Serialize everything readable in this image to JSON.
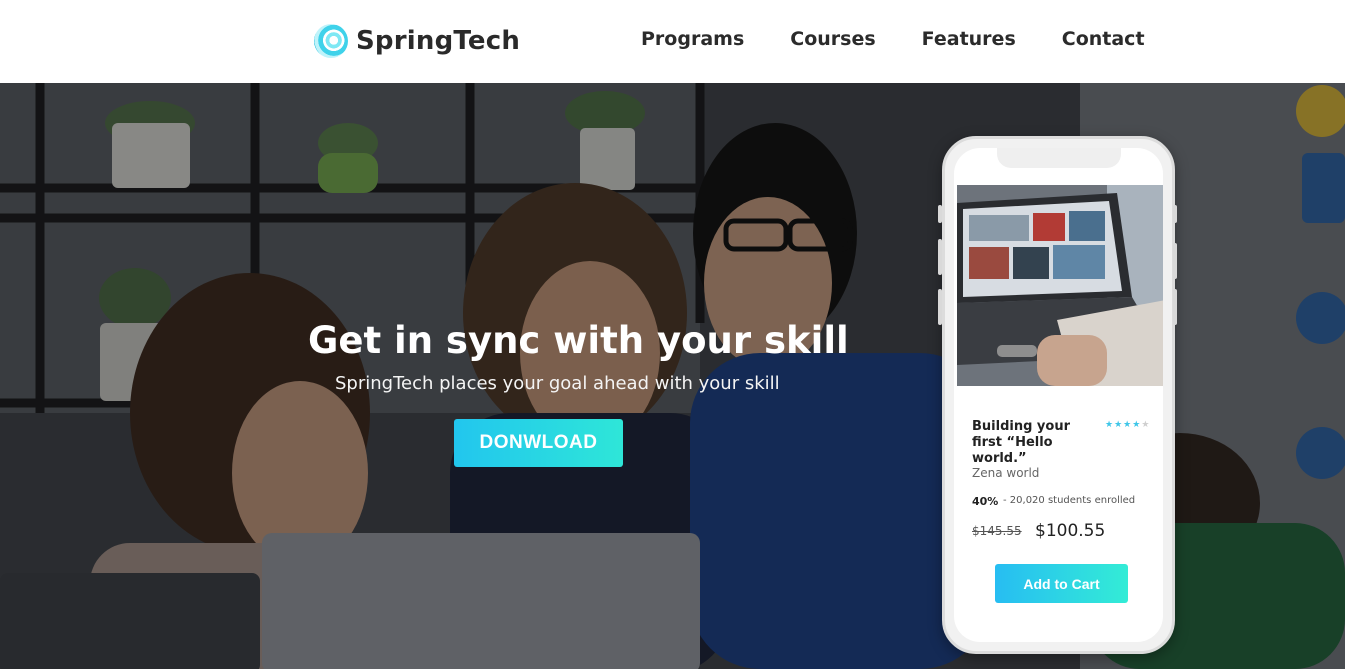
{
  "brand": {
    "name": "SpringTech",
    "logo_icon": "spiral-logo-icon"
  },
  "nav": {
    "items": [
      {
        "label": "Programs"
      },
      {
        "label": "Courses"
      },
      {
        "label": "Features"
      },
      {
        "label": "Contact"
      }
    ]
  },
  "hero": {
    "title": "Get in sync with your skill",
    "subtitle": "SpringTech places your goal ahead with your skill",
    "cta_label": "DONWLOAD"
  },
  "course_card": {
    "title": "Building your first “Hello world.”",
    "rating_stars_filled": 4,
    "rating_stars_total": 5,
    "author": "Zena world",
    "discount": "40%",
    "enrolled": "- 20,020 students enrolled",
    "old_price": "$145.55",
    "new_price": "$100.55",
    "cart_label": "Add to Cart"
  },
  "colors": {
    "accent_start": "#22c6ee",
    "accent_end": "#2ee6d8",
    "star_active": "#3ec6e8",
    "text_dark": "#2b2b2b"
  }
}
